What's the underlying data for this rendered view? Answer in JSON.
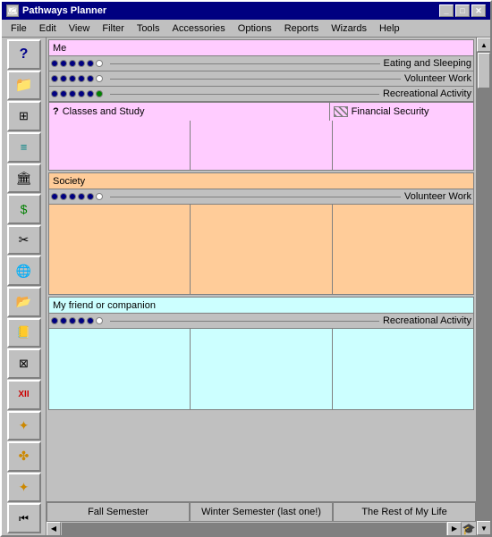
{
  "window": {
    "title": "Pathways Planner",
    "icon": "🗺"
  },
  "menu": {
    "items": [
      "File",
      "Edit",
      "View",
      "Filter",
      "Tools",
      "Accessories",
      "Options",
      "Reports",
      "Wizards",
      "Help"
    ]
  },
  "sidebar": {
    "buttons": [
      {
        "id": "btn1",
        "icon": "?",
        "label": "help-button"
      },
      {
        "id": "btn2",
        "icon": "📁",
        "label": "folder-button"
      },
      {
        "id": "btn3",
        "icon": "▦",
        "label": "grid-button"
      },
      {
        "id": "btn4",
        "icon": "≡",
        "label": "list-button"
      },
      {
        "id": "btn5",
        "icon": "🏛",
        "label": "building-button"
      },
      {
        "id": "btn6",
        "icon": "$",
        "label": "dollar-button"
      },
      {
        "id": "btn7",
        "icon": "✂",
        "label": "tools-button"
      },
      {
        "id": "btn8",
        "icon": "🌐",
        "label": "globe-button"
      },
      {
        "id": "btn9",
        "icon": "📂",
        "label": "open-folder-button"
      },
      {
        "id": "btn10",
        "icon": "📒",
        "label": "notebook-button"
      },
      {
        "id": "btn11",
        "icon": "⚙",
        "label": "gear-button"
      },
      {
        "id": "btn12",
        "icon": "XII",
        "label": "calendar-button"
      },
      {
        "id": "btn13",
        "icon": "✦",
        "label": "star-up-button"
      },
      {
        "id": "btn14",
        "icon": "✤",
        "label": "star-mid-button"
      },
      {
        "id": "btn15",
        "icon": "✦",
        "label": "star-down-button"
      },
      {
        "id": "btn16",
        "icon": "⏮",
        "label": "skip-button"
      }
    ]
  },
  "sections": {
    "pink_section": {
      "title": "Me",
      "rows": [
        {
          "dots": [
            1,
            1,
            1,
            1,
            1,
            0
          ],
          "label": "Eating and Sleeping"
        },
        {
          "dots": [
            1,
            1,
            1,
            1,
            1,
            0
          ],
          "label": "Volunteer Work"
        },
        {
          "dots": [
            1,
            1,
            1,
            1,
            1,
            1
          ],
          "label": "Recreational Activity"
        }
      ],
      "bottom_left": "Classes and Study",
      "bottom_right": "Financial Security",
      "question_mark": "?"
    },
    "peach_section": {
      "title": "Society",
      "rows": [
        {
          "dots": [
            1,
            1,
            1,
            1,
            1,
            0
          ],
          "label": "Volunteer Work"
        }
      ]
    },
    "blue_section": {
      "title": "My friend or companion",
      "rows": [
        {
          "dots": [
            1,
            1,
            1,
            1,
            1,
            0
          ],
          "label": "Recreational Activity"
        }
      ]
    }
  },
  "bottom_tabs": {
    "tabs": [
      "Fall Semester",
      "Winter Semester (last one!)",
      "The Rest of My Life"
    ]
  },
  "title_buttons": {
    "minimize": "_",
    "maximize": "□",
    "close": "✕"
  }
}
